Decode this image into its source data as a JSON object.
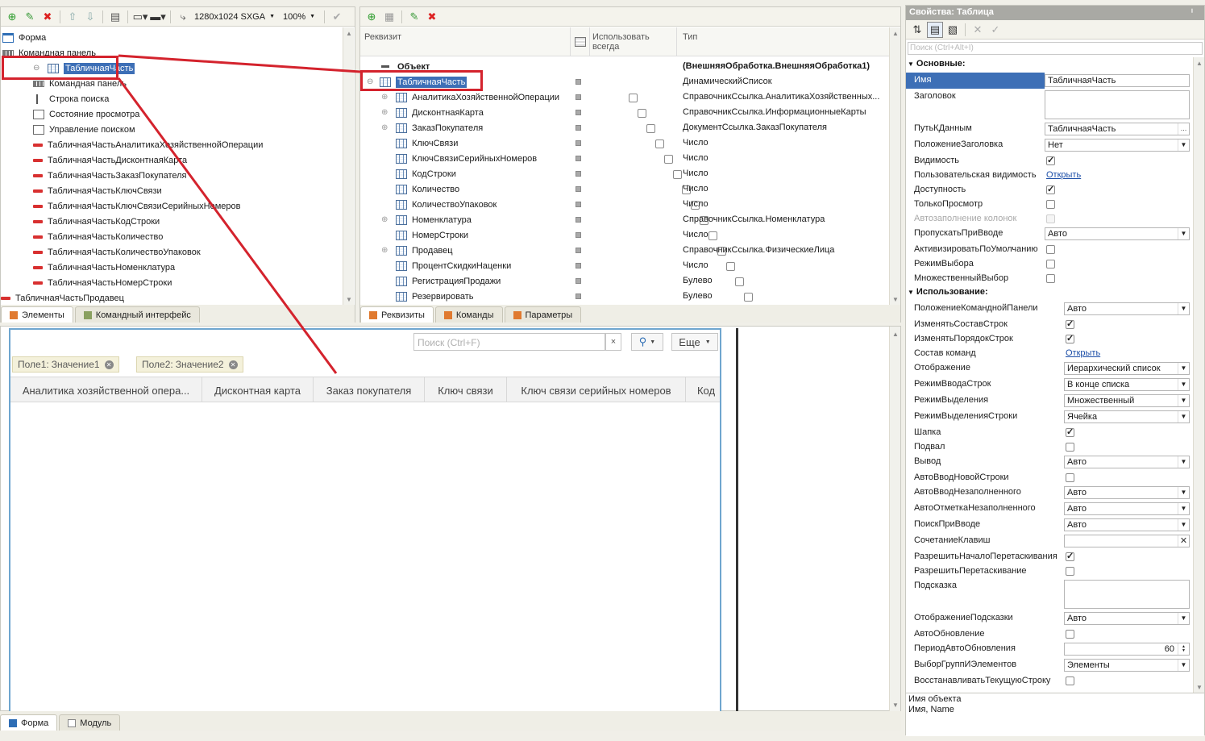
{
  "top_toolbar": {
    "resolution": "1280x1024 SXGA",
    "zoom": "100%"
  },
  "form_tree": {
    "root": "Форма",
    "items": [
      {
        "label": "Командная панель",
        "icon": "command-bar-icon"
      },
      {
        "label": "ТабличнаяЧасть",
        "icon": "table-icon"
      },
      {
        "label": "Командная панель",
        "icon": "command-bar-icon"
      },
      {
        "label": "Строка поиска",
        "icon": "search-line-icon"
      },
      {
        "label": "Состояние просмотра",
        "icon": "view-state-icon"
      },
      {
        "label": "Управление поиском",
        "icon": "search-control-icon"
      },
      {
        "label": "ТабличнаяЧастьАналитикаХозяйственнойОперации",
        "icon": "field-icon"
      },
      {
        "label": "ТабличнаяЧастьДисконтнаяКарта",
        "icon": "field-icon"
      },
      {
        "label": "ТабличнаяЧастьЗаказПокупателя",
        "icon": "field-icon"
      },
      {
        "label": "ТабличнаяЧастьКлючСвязи",
        "icon": "field-icon"
      },
      {
        "label": "ТабличнаяЧастьКлючСвязиСерийныхНомеров",
        "icon": "field-icon"
      },
      {
        "label": "ТабличнаяЧастьКодСтроки",
        "icon": "field-icon"
      },
      {
        "label": "ТабличнаяЧастьКоличество",
        "icon": "field-icon"
      },
      {
        "label": "ТабличнаяЧастьКоличествоУпаковок",
        "icon": "field-icon"
      },
      {
        "label": "ТабличнаяЧастьНоменклатура",
        "icon": "field-icon"
      },
      {
        "label": "ТабличнаяЧастьНомерСтроки",
        "icon": "field-icon"
      },
      {
        "label": "ТабличнаяЧастьПродавец",
        "icon": "field-icon"
      }
    ],
    "tabs": [
      "Элементы",
      "Командный интерфейс"
    ]
  },
  "attributes": {
    "headers": {
      "name": "Реквизит",
      "always": "Использовать всегда",
      "type": "Тип"
    },
    "object": {
      "name": "Объект",
      "type": "(ВнешняяОбработка.ВнешняяОбработка1)"
    },
    "table": {
      "name": "ТабличнаяЧасть",
      "type": "ДинамическийСписок"
    },
    "rows": [
      {
        "name": "АналитикаХозяйственнойОперации",
        "type": "СправочникСсылка.АналитикаХозяйственных...",
        "expand": true
      },
      {
        "name": "ДисконтнаяКарта",
        "type": "СправочникСсылка.ИнформационныеКарты",
        "expand": true
      },
      {
        "name": "ЗаказПокупателя",
        "type": "ДокументСсылка.ЗаказПокупателя",
        "expand": true
      },
      {
        "name": "КлючСвязи",
        "type": "Число",
        "expand": false
      },
      {
        "name": "КлючСвязиСерийныхНомеров",
        "type": "Число",
        "expand": false
      },
      {
        "name": "КодСтроки",
        "type": "Число",
        "expand": false
      },
      {
        "name": "Количество",
        "type": "Число",
        "expand": false
      },
      {
        "name": "КоличествоУпаковок",
        "type": "Число",
        "expand": false
      },
      {
        "name": "Номенклатура",
        "type": "СправочникСсылка.Номенклатура",
        "expand": true
      },
      {
        "name": "НомерСтроки",
        "type": "Число",
        "expand": false
      },
      {
        "name": "Продавец",
        "type": "СправочникСсылка.ФизическиеЛица",
        "expand": true
      },
      {
        "name": "ПроцентСкидкиНаценки",
        "type": "Число",
        "expand": false
      },
      {
        "name": "РегистрацияПродажи",
        "type": "Булево",
        "expand": false
      },
      {
        "name": "Резервировать",
        "type": "Булево",
        "expand": false
      }
    ],
    "tabs": [
      "Реквизиты",
      "Команды",
      "Параметры"
    ]
  },
  "preview": {
    "search_placeholder": "Поиск (Ctrl+F)",
    "clear": "×",
    "more": "Еще",
    "chips": [
      {
        "field": "Поле1:",
        "value": "Значение1"
      },
      {
        "field": "Поле2:",
        "value": "Значение2"
      }
    ],
    "columns": [
      "Аналитика хозяйственной опера...",
      "Дисконтная карта",
      "Заказ покупателя",
      "Ключ связи",
      "Ключ связи серийных номеров",
      "Код"
    ]
  },
  "bottom_tabs": [
    "Форма",
    "Модуль"
  ],
  "properties": {
    "title": "Свойства: Таблица",
    "search_placeholder": "Поиск (Ctrl+Alt+I)",
    "section_main": "Основные:",
    "section_usage": "Использование:",
    "main": [
      {
        "label": "Имя",
        "value": "ТабличнаяЧасть",
        "kind": "text"
      },
      {
        "label": "Заголовок",
        "value": "",
        "kind": "area"
      },
      {
        "label": "ПутьКДанным",
        "value": "ТабличнаяЧасть",
        "kind": "select-dots"
      },
      {
        "label": "ПоложениеЗаголовка",
        "value": "Нет",
        "kind": "dropdown"
      },
      {
        "label": "Видимость",
        "value": true,
        "kind": "check"
      },
      {
        "label": "Пользовательская видимость",
        "value": "Открыть",
        "kind": "link"
      },
      {
        "label": "Доступность",
        "value": true,
        "kind": "check"
      },
      {
        "label": "ТолькоПросмотр",
        "value": false,
        "kind": "check"
      },
      {
        "label": "Автозаполнение колонок",
        "value": false,
        "kind": "check-disabled"
      },
      {
        "label": "ПропускатьПриВводе",
        "value": "Авто",
        "kind": "dropdown"
      },
      {
        "label": "АктивизироватьПоУмолчанию",
        "value": false,
        "kind": "check"
      },
      {
        "label": "РежимВыбора",
        "value": false,
        "kind": "check"
      },
      {
        "label": "МножественныйВыбор",
        "value": false,
        "kind": "check"
      }
    ],
    "usage": [
      {
        "label": "ПоложениеКоманднойПанели",
        "value": "Авто",
        "kind": "dropdown"
      },
      {
        "label": "ИзменятьСоставСтрок",
        "value": true,
        "kind": "check"
      },
      {
        "label": "ИзменятьПорядокСтрок",
        "value": true,
        "kind": "check"
      },
      {
        "label": "Состав команд",
        "value": "Открыть",
        "kind": "link"
      },
      {
        "label": "Отображение",
        "value": "Иерархический список",
        "kind": "dropdown"
      },
      {
        "label": "РежимВводаСтрок",
        "value": "В конце списка",
        "kind": "dropdown"
      },
      {
        "label": "РежимВыделения",
        "value": "Множественный",
        "kind": "dropdown"
      },
      {
        "label": "РежимВыделенияСтроки",
        "value": "Ячейка",
        "kind": "dropdown"
      },
      {
        "label": "Шапка",
        "value": true,
        "kind": "check"
      },
      {
        "label": "Подвал",
        "value": false,
        "kind": "check"
      },
      {
        "label": "Вывод",
        "value": "Авто",
        "kind": "dropdown"
      },
      {
        "label": "АвтоВводНовойСтроки",
        "value": false,
        "kind": "check"
      },
      {
        "label": "АвтоВводНезаполненного",
        "value": "Авто",
        "kind": "dropdown"
      },
      {
        "label": "АвтоОтметкаНезаполненного",
        "value": "Авто",
        "kind": "dropdown"
      },
      {
        "label": "ПоискПриВводе",
        "value": "Авто",
        "kind": "dropdown"
      },
      {
        "label": "СочетаниеКлавиш",
        "value": "",
        "kind": "clear"
      },
      {
        "label": "РазрешитьНачалоПеретаскивания",
        "value": true,
        "kind": "check"
      },
      {
        "label": "РазрешитьПеретаскивание",
        "value": false,
        "kind": "check"
      },
      {
        "label": "Подсказка",
        "value": "",
        "kind": "area"
      },
      {
        "label": "ОтображениеПодсказки",
        "value": "Авто",
        "kind": "dropdown"
      },
      {
        "label": "АвтоОбновление",
        "value": false,
        "kind": "check"
      },
      {
        "label": "ПериодАвтоОбновления",
        "value": "60",
        "kind": "spin"
      },
      {
        "label": "ВыборГруппИЭлементов",
        "value": "Элементы",
        "kind": "dropdown"
      },
      {
        "label": "ВосстанавливатьТекущуюСтроку",
        "value": false,
        "kind": "check"
      }
    ],
    "footer": {
      "line1": "Имя объекта",
      "line2": "Имя, Name"
    }
  },
  "colors": {
    "accent": "#3d6fb6",
    "annotation_red": "#d4232d",
    "link": "#1d4fa8"
  }
}
